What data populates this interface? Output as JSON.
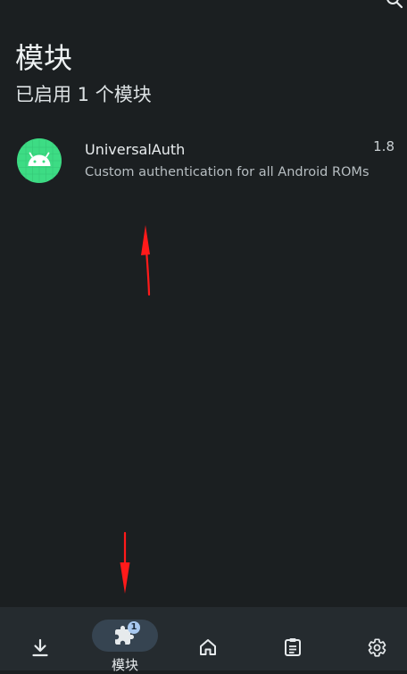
{
  "header": {
    "title": "模块",
    "subtitle": "已启用 1 个模块"
  },
  "modules": [
    {
      "name": "UniversalAuth",
      "description": "Custom authentication for all Android ROMs",
      "version": "1.8",
      "icon": "android-icon"
    }
  ],
  "bottom_nav": {
    "items": [
      {
        "id": "download",
        "icon": "download-icon",
        "label": ""
      },
      {
        "id": "modules",
        "icon": "puzzle-icon",
        "label": "模块",
        "badge": "1",
        "selected": true
      },
      {
        "id": "home",
        "icon": "home-icon",
        "label": ""
      },
      {
        "id": "logs",
        "icon": "clipboard-icon",
        "label": ""
      },
      {
        "id": "settings",
        "icon": "gear-icon",
        "label": ""
      }
    ]
  },
  "colors": {
    "background": "#1b1f21",
    "nav_background": "#252b2f",
    "selected_pill": "#364451",
    "badge": "#a8c8ef",
    "module_icon_bg": "#3ddc84",
    "annotation_arrow": "#ff1a1a"
  }
}
